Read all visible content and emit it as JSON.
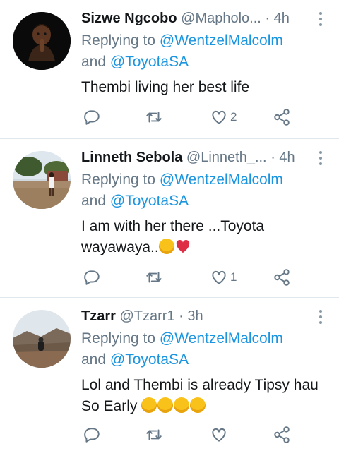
{
  "tweets": [
    {
      "name": "Sizwe Ngcobo",
      "handle": "@Mapholo...",
      "dot": "·",
      "time": "4h",
      "replying_prefix": "Replying to",
      "mention1": "@WentzelMalcolm",
      "and": "and",
      "mention2": "@ToyotaSA",
      "text": "Thembi living her best life",
      "like_count": "2"
    },
    {
      "name": "Linneth Sebola",
      "handle": "@Linneth_...",
      "dot": "·",
      "time": "4h",
      "replying_prefix": "Replying to",
      "mention1": "@WentzelMalcolm",
      "and": "and",
      "mention2": "@ToyotaSA",
      "text_line1": "I am with her there ...Toyota",
      "text_line2": "wayawaya..",
      "like_count": "1"
    },
    {
      "name": "Tzarr",
      "handle": "@Tzarr1",
      "dot": "·",
      "time": "3h",
      "replying_prefix": "Replying to",
      "mention1": "@WentzelMalcolm",
      "and": "and",
      "mention2": "@ToyotaSA",
      "text_line1": "Lol and Thembi is already Tipsy hau",
      "text_line2": "So Early",
      "like_count": ""
    }
  ],
  "icons": {
    "reply": "reply-icon",
    "retweet": "retweet-icon",
    "like": "heart-icon",
    "share": "share-icon",
    "more": "more-vertical-icon"
  },
  "colors": {
    "accent": "#1b95e0",
    "muted": "#657786",
    "divider": "#e1e8ed",
    "text": "#14171a"
  }
}
